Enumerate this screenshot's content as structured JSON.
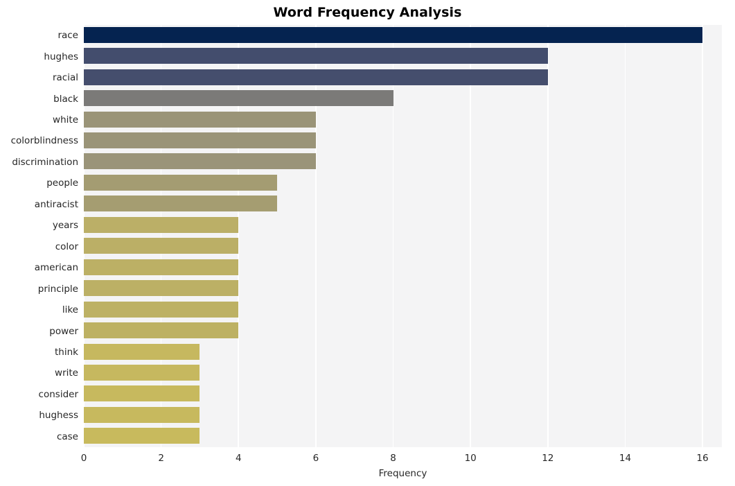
{
  "chart_data": {
    "type": "bar",
    "orientation": "horizontal",
    "title": "Word Frequency Analysis",
    "xlabel": "Frequency",
    "ylabel": "",
    "xlim": [
      0,
      16.5
    ],
    "xticks": [
      0,
      2,
      4,
      6,
      8,
      10,
      12,
      14,
      16
    ],
    "xticklabels": [
      "0",
      "2",
      "4",
      "6",
      "8",
      "10",
      "12",
      "14",
      "16"
    ],
    "grid": true,
    "grid_axis": "x",
    "legend": false,
    "categories": [
      "race",
      "hughes",
      "racial",
      "black",
      "white",
      "colorblindness",
      "discrimination",
      "people",
      "antiracist",
      "years",
      "color",
      "american",
      "principle",
      "like",
      "power",
      "think",
      "write",
      "consider",
      "hughess",
      "case"
    ],
    "values": [
      16,
      12,
      12,
      8,
      6,
      6,
      6,
      5,
      5,
      4,
      4,
      4,
      4,
      4,
      4,
      3,
      3,
      3,
      3,
      3
    ],
    "bar_colors": [
      "#052350",
      "#434d6d",
      "#454e6d",
      "#7b7a78",
      "#9a9478",
      "#9a9478",
      "#9a9479",
      "#a49c72",
      "#a59d71",
      "#bbaf67",
      "#bbaf66",
      "#bcb065",
      "#bcb065",
      "#bdb164",
      "#bdb163",
      "#c6b85f",
      "#c6b85f",
      "#c7b95e",
      "#c7b95e",
      "#c8ba5d"
    ],
    "plot_bgcolor": "#f4f4f5",
    "grid_color": "#ffffff",
    "figure_bgcolor": "#ffffff",
    "text_color": "#262626"
  }
}
